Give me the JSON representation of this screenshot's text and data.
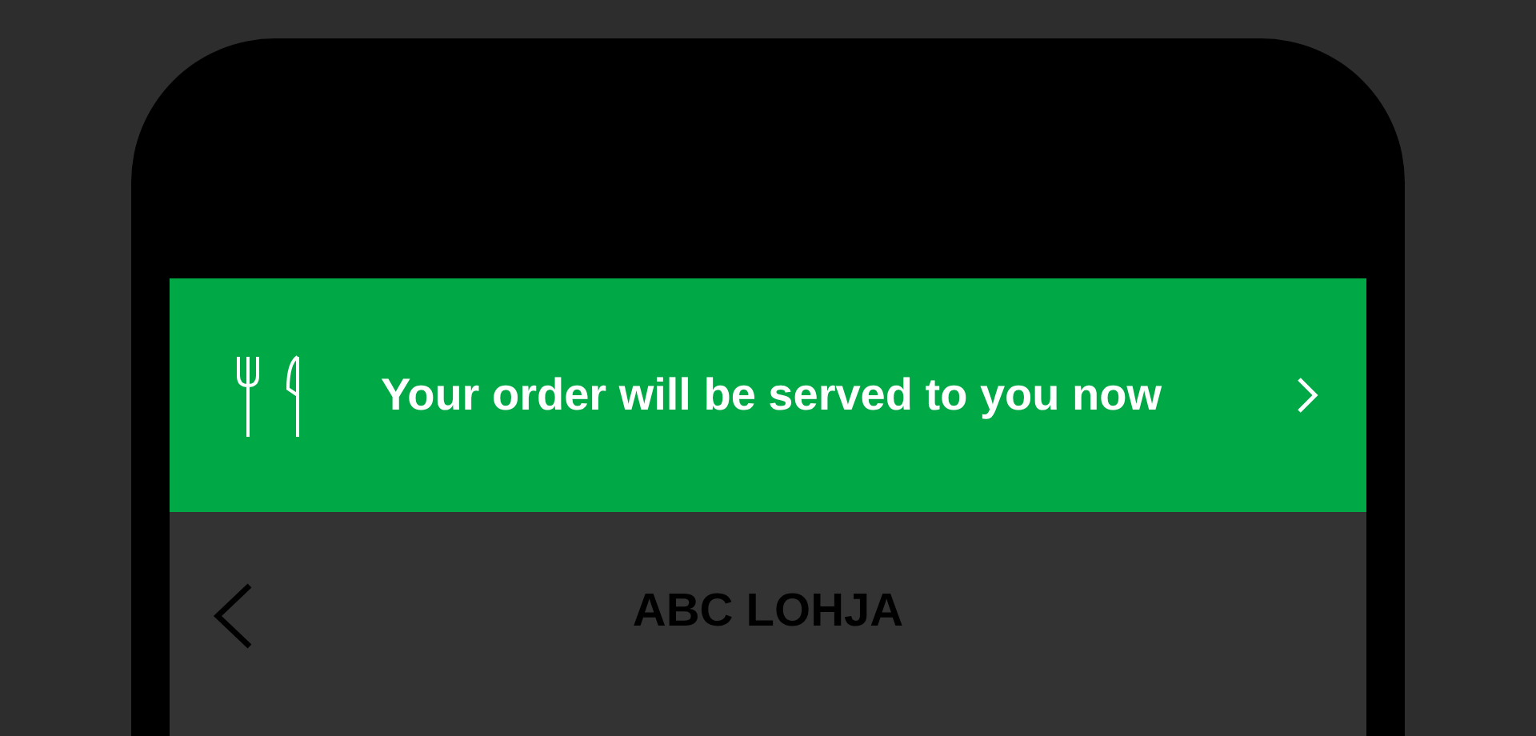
{
  "banner": {
    "message": "Your order will be served to you now"
  },
  "header": {
    "title": "ABC LOHJA"
  }
}
